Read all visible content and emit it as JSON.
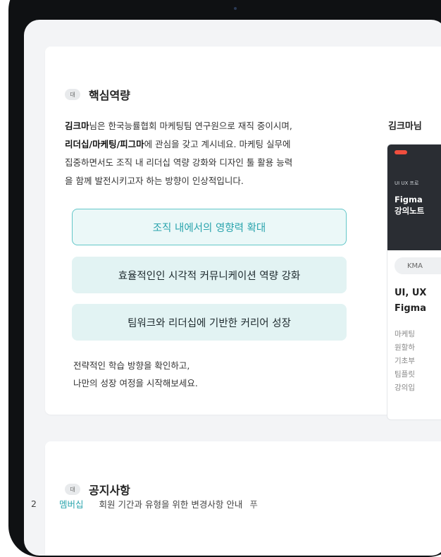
{
  "core": {
    "icon_label": "대",
    "title": "핵심역량",
    "intro": {
      "name": "김크마",
      "line1_rest": "님은 한국능률협회 마케팅팀 연구원으로 재직 중이시며,",
      "interests": "리더십/마케팅/피그마",
      "line2_rest": "에 관심을 갖고 계시네요. 마케팅 실무에",
      "line3": "집중하면서도 조직 내 리더십 역량 강화와 디자인 툴 활용 능력",
      "line4": "을 함께 발전시키고자 하는 방향이 인상적입니다."
    },
    "goals": [
      "조직 내에서의 영향력 확대",
      "효율적인인 시각적 커뮤니케이션 역량 강화",
      "팀워크와 리더십에 기반한 커리어 성장"
    ],
    "outro": [
      "전략적인 학습 방향을 확인하고,",
      "나만의 성장 여정을 시작해보세요."
    ]
  },
  "side": {
    "title": "김크마님",
    "thumb_small": "UI UX 프로",
    "thumb_big": [
      "Figma",
      "강의노트"
    ],
    "badge": "KMA",
    "course_title": [
      "UI, UX",
      "Figma"
    ],
    "desc": [
      "마케팅",
      "원할하",
      "기초부",
      "팀플릿",
      "강의입"
    ]
  },
  "notice": {
    "icon_label": "대",
    "title": "공지사항",
    "rows": [
      {
        "num": "2",
        "category": "멤버십",
        "title": "회원 기간과 유형을 위한 변경사항 안내",
        "pin": "푸"
      }
    ]
  }
}
